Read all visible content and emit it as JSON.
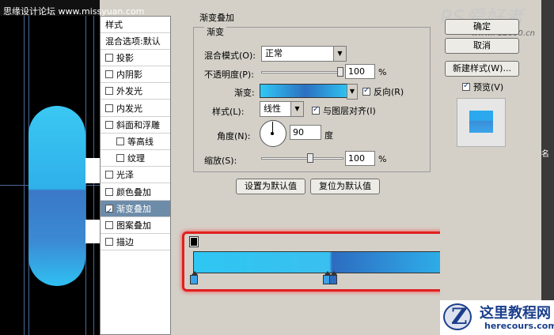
{
  "watermark_left": "思缘设计论坛 www.missyuan.com",
  "style_list": {
    "header": "样式",
    "blend_options": "混合选项:默认",
    "items": [
      {
        "label": "投影",
        "checked": false,
        "sub": false
      },
      {
        "label": "内阴影",
        "checked": false,
        "sub": false
      },
      {
        "label": "外发光",
        "checked": false,
        "sub": false
      },
      {
        "label": "内发光",
        "checked": false,
        "sub": false
      },
      {
        "label": "斜面和浮雕",
        "checked": false,
        "sub": false
      },
      {
        "label": "等高线",
        "checked": false,
        "sub": true
      },
      {
        "label": "纹理",
        "checked": false,
        "sub": true
      },
      {
        "label": "光泽",
        "checked": false,
        "sub": false
      },
      {
        "label": "颜色叠加",
        "checked": false,
        "sub": false
      },
      {
        "label": "渐变叠加",
        "checked": true,
        "sub": false,
        "selected": true
      },
      {
        "label": "图案叠加",
        "checked": false,
        "sub": false
      },
      {
        "label": "描边",
        "checked": false,
        "sub": false
      }
    ]
  },
  "dialog": {
    "section_title": "渐变叠加",
    "group_title": "渐变",
    "blend_mode_label": "混合模式(O):",
    "blend_mode_value": "正常",
    "opacity_label": "不透明度(P):",
    "opacity_value": "100",
    "opacity_unit": "%",
    "gradient_label": "渐变:",
    "reverse_label": "反向(R)",
    "reverse_checked": true,
    "style_label": "样式(L):",
    "style_value": "线性",
    "align_label": "与图层对齐(I)",
    "align_checked": true,
    "angle_label": "角度(N):",
    "angle_value": "90",
    "angle_unit": "度",
    "scale_label": "缩放(S):",
    "scale_value": "100",
    "scale_unit": "%",
    "set_default_button": "设置为默认值",
    "reset_default_button": "复位为默认值"
  },
  "right_panel": {
    "ok_button": "确定",
    "cancel_button": "取消",
    "new_style_button": "新建样式(W)...",
    "preview_label": "预览(V)",
    "preview_checked": true,
    "logo_text": "PS爱好者",
    "logo_url": "www.PS2000.cn",
    "side_label": "名"
  },
  "bottom_logo": {
    "name": "这里教程网",
    "url": "herecours.com"
  },
  "colors": {
    "gradient_light": "#2ec6f2",
    "gradient_dark": "#2d6cc0",
    "highlight_frame": "#e02020",
    "selected_row": "#6d8ca9"
  }
}
